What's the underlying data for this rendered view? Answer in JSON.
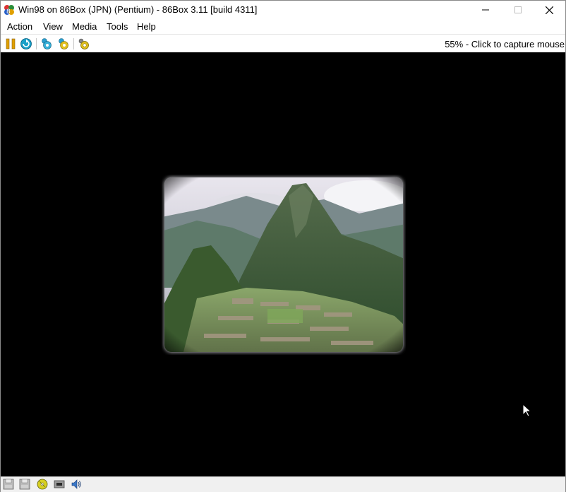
{
  "window": {
    "title": "Win98 on 86Box (JPN) (Pentium) - 86Box 3.11 [build 4311]",
    "app_icon": "86box-icon",
    "controls": {
      "minimize": "minimize-icon",
      "maximize": "maximize-icon",
      "close": "close-icon"
    }
  },
  "menubar": {
    "items": [
      {
        "label": "Action"
      },
      {
        "label": "View"
      },
      {
        "label": "Media"
      },
      {
        "label": "Tools"
      },
      {
        "label": "Help"
      }
    ]
  },
  "toolbar": {
    "buttons": [
      {
        "icon": "pause-icon"
      },
      {
        "icon": "hard-reset-icon"
      },
      {
        "icon": "ctrl-alt-del-icon"
      },
      {
        "icon": "ctrl-alt-esc-icon"
      },
      {
        "icon": "settings-icon"
      }
    ],
    "capture_hint": "55% - Click to capture mouse"
  },
  "screen": {
    "background": "#000000",
    "image": "machu-picchu-photo"
  },
  "statusbar": {
    "icons": [
      {
        "icon": "floppy-drive-icon"
      },
      {
        "icon": "floppy-drive-2-icon"
      },
      {
        "icon": "cdrom-drive-icon"
      },
      {
        "icon": "network-icon"
      },
      {
        "icon": "sound-icon"
      }
    ]
  },
  "colors": {
    "titlebar_bg": "#ffffff",
    "screen_bg": "#000000",
    "accent_pause": "#e0a000",
    "accent_reset": "#1aa0c8"
  }
}
